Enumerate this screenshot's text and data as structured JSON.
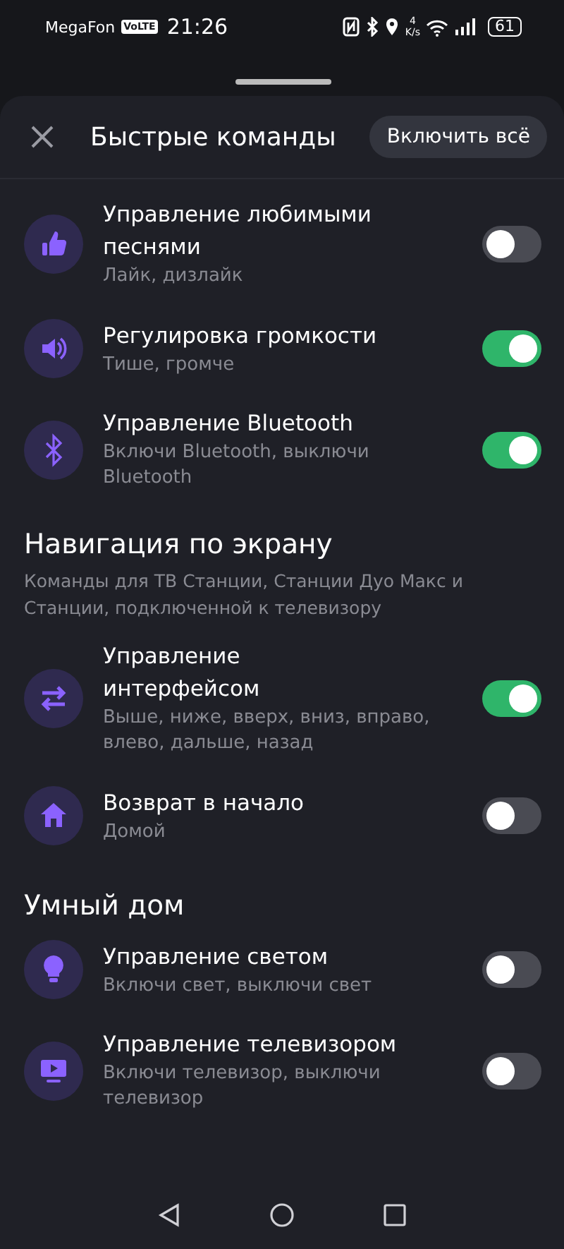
{
  "status_bar": {
    "carrier": "MegaFon",
    "volte": "VoLTE",
    "time": "21:26",
    "speed_value": "4",
    "speed_unit": "K/s",
    "battery": "61"
  },
  "header": {
    "title": "Быстрые команды",
    "action": "Включить всё"
  },
  "sections": [
    {
      "items": [
        {
          "kind": "like",
          "title": "Управление любимыми песнями",
          "subtitle": "Лайк, дизлайк",
          "on": false
        },
        {
          "kind": "volume",
          "title": "Регулировка громкости",
          "subtitle": "Тише, громче",
          "on": true
        },
        {
          "kind": "bluetooth",
          "title": "Управление Bluetooth",
          "subtitle": "Включи Bluetooth, выключи Bluetooth",
          "on": true
        }
      ]
    },
    {
      "title": "Навигация по экрану",
      "description": "Команды для ТВ Станции, Станции Дуо Макс и Станции, подключенной к телевизору",
      "items": [
        {
          "kind": "arrows",
          "title": "Управление интерфейсом",
          "subtitle": "Выше, ниже, вверх, вниз, вправо, влево, дальше, назад",
          "on": true
        },
        {
          "kind": "home",
          "title": "Возврат в начало",
          "subtitle": "Домой",
          "on": false
        }
      ]
    },
    {
      "title": "Умный дом",
      "items": [
        {
          "kind": "bulb",
          "title": "Управление светом",
          "subtitle": "Включи свет, выключи свет",
          "on": false
        },
        {
          "kind": "tv",
          "title": "Управление телевизором",
          "subtitle": "Включи телевизор, выключи телевизор",
          "on": false
        }
      ]
    }
  ]
}
